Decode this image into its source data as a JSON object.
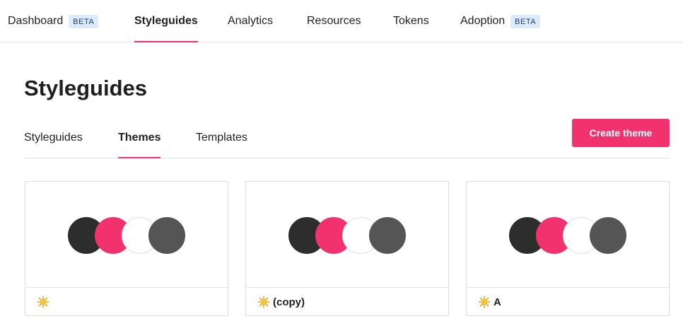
{
  "topnav": {
    "items": [
      {
        "label": "Dashboard",
        "badge": "BETA",
        "active": false
      },
      {
        "label": "Styleguides",
        "badge": "",
        "active": true
      },
      {
        "label": "Analytics",
        "badge": "",
        "active": false
      },
      {
        "label": "Resources",
        "badge": "",
        "active": false
      },
      {
        "label": "Tokens",
        "badge": "",
        "active": false
      },
      {
        "label": "Adoption",
        "badge": "BETA",
        "active": false
      }
    ]
  },
  "page": {
    "title": "Styleguides"
  },
  "subtabs": {
    "items": [
      {
        "label": "Styleguides",
        "active": false
      },
      {
        "label": "Themes",
        "active": true
      },
      {
        "label": "Templates",
        "active": false
      }
    ]
  },
  "actions": {
    "create_label": "Create theme"
  },
  "colors": {
    "accent": "#f2326f",
    "badge_bg": "#dbeafe"
  },
  "themes": [
    {
      "icon": "sun-icon",
      "name": "",
      "swatches": [
        "#2d2d2d",
        "#f2326f",
        "#ffffff",
        "#555555"
      ]
    },
    {
      "icon": "sun-icon",
      "name": "(copy)",
      "swatches": [
        "#2d2d2d",
        "#f2326f",
        "#ffffff",
        "#555555"
      ]
    },
    {
      "icon": "sun-icon",
      "name": "A",
      "swatches": [
        "#2d2d2d",
        "#f2326f",
        "#ffffff",
        "#555555"
      ]
    }
  ]
}
